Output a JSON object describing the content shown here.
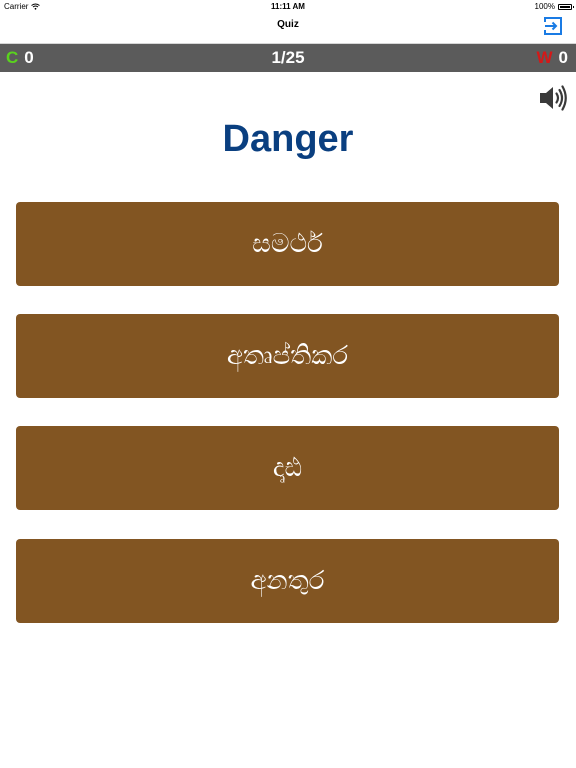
{
  "status_bar": {
    "carrier": "Carrier",
    "time": "11:11 AM",
    "battery": "100%"
  },
  "nav": {
    "title": "Quiz",
    "exit_icon": "exit-icon",
    "accent": "#1a7be4"
  },
  "score": {
    "correct_label": "C",
    "correct_count": "0",
    "progress": "1/25",
    "wrong_label": "W",
    "wrong_count": "0",
    "correct_color": "#5ad21e",
    "wrong_color": "#d41818"
  },
  "question": {
    "word": "Danger",
    "speaker_icon": "speaker-icon"
  },
  "options": [
    {
      "label": "සමර්ථ"
    },
    {
      "label": "අතෘප්තිකර"
    },
    {
      "label": "දෘඪ"
    },
    {
      "label": "අනතුර"
    }
  ],
  "colors": {
    "option_bg": "#825522",
    "word": "#0a3f80",
    "score_bar": "#5b5b5b"
  }
}
